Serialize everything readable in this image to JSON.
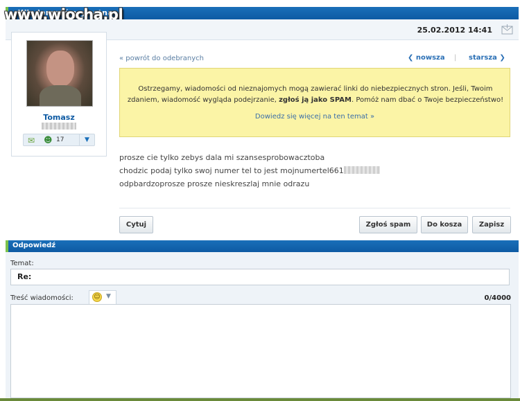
{
  "header": {
    "title": "Wiadomość prywatna",
    "watermark": "www.wiocha.pl",
    "date": "25.02.2012 14:41"
  },
  "sender": {
    "name": "Tomasz",
    "friends_count": "17"
  },
  "nav": {
    "back": "« powrót do odebranych",
    "newer": "❮ nowsza",
    "separator": "|",
    "older": "starsza ❯"
  },
  "warning": {
    "text_before": "Ostrzegamy, wiadomości od nieznajomych mogą zawierać linki do niebezpiecznych stron. Jeśli, Twoim zdaniem, wiadomość wygląda podejrzanie, ",
    "text_bold": "zgłoś ją jako SPAM",
    "text_after": ". Pomóż nam dbać o Twoje bezpieczeństwo!",
    "link": "Dowiedz się więcej na ten temat »"
  },
  "message": {
    "line1": "prosze cie tylko zebys dala mi szansesprobowacztoba",
    "line2": "chodzic podaj tylko swoj numer tel to jest mojnumertel661",
    "line3": "odpbardzoprosze prosze nieskreszlaj mnie odrazu"
  },
  "actions": {
    "quote": "Cytuj",
    "spam": "Zgłoś spam",
    "trash": "Do kosza",
    "save": "Zapisz"
  },
  "reply": {
    "title": "Odpowiedź",
    "subject_label": "Temat:",
    "subject_value": "Re:",
    "content_label": "Treść wiadomości:",
    "char_count": "0/4000"
  },
  "colors": {
    "header_blue": "#0d5aa3",
    "accent_green": "#7bc24b",
    "warning_bg": "#fbf4a6"
  }
}
